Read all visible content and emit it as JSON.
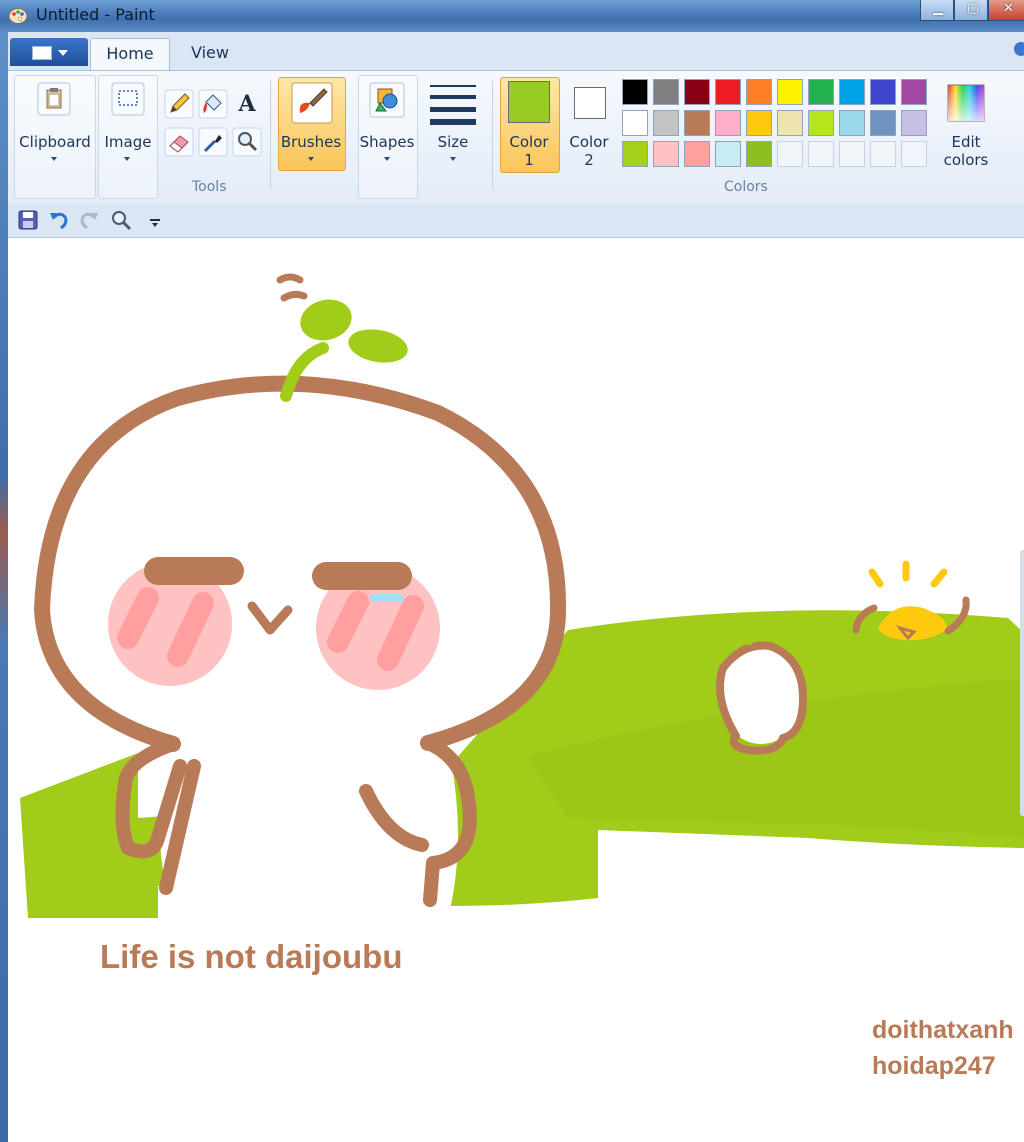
{
  "window": {
    "title": "Untitled - Paint"
  },
  "tabs": [
    {
      "label": "Home",
      "active": true
    },
    {
      "label": "View",
      "active": false
    }
  ],
  "ribbon": {
    "clipboard_label": "Clipboard",
    "image_label": "Image",
    "tools_group_label": "Tools",
    "brushes_label": "Brushes",
    "shapes_label": "Shapes",
    "size_label": "Size",
    "color1_label": "Color",
    "color1_sub": "1",
    "color2_label": "Color",
    "color2_sub": "2",
    "edit_colors_label": "Edit",
    "edit_colors_sub": "colors",
    "colors_group_label": "Colors",
    "color1_value": "#99cc22",
    "color2_value": "#ffffff"
  },
  "palette": {
    "row1": [
      "#000000",
      "#7f7f7f",
      "#880015",
      "#ed1c24",
      "#ff7f27",
      "#fff200",
      "#22b14c",
      "#00a2e8",
      "#3f48cc",
      "#a349a4"
    ],
    "row2": [
      "#ffffff",
      "#c3c3c3",
      "#b97a57",
      "#ffaec9",
      "#ffc90e",
      "#efe4b0",
      "#b5e61d",
      "#99d9ea",
      "#7092be",
      "#c8bfe7"
    ],
    "row3": [
      "#a5d11b",
      "#ffc2c2",
      "#ff9f9f",
      "#c9ebf2",
      "#8fbf1f"
    ],
    "empty_slots": 5
  },
  "canvas": {
    "caption": "Life is not daijoubu",
    "watermark_line1": "doithatxanh",
    "watermark_line2": "hoidap247",
    "colors": {
      "brown": "#b97a57",
      "green": "#a1cc19",
      "pink": "#ffb3b8",
      "yellow": "#ffc90e"
    }
  },
  "icons": {
    "app": "paint-palette-icon",
    "save": "save-icon",
    "undo": "undo-icon",
    "redo": "redo-icon",
    "zoom": "magnifier-icon"
  }
}
